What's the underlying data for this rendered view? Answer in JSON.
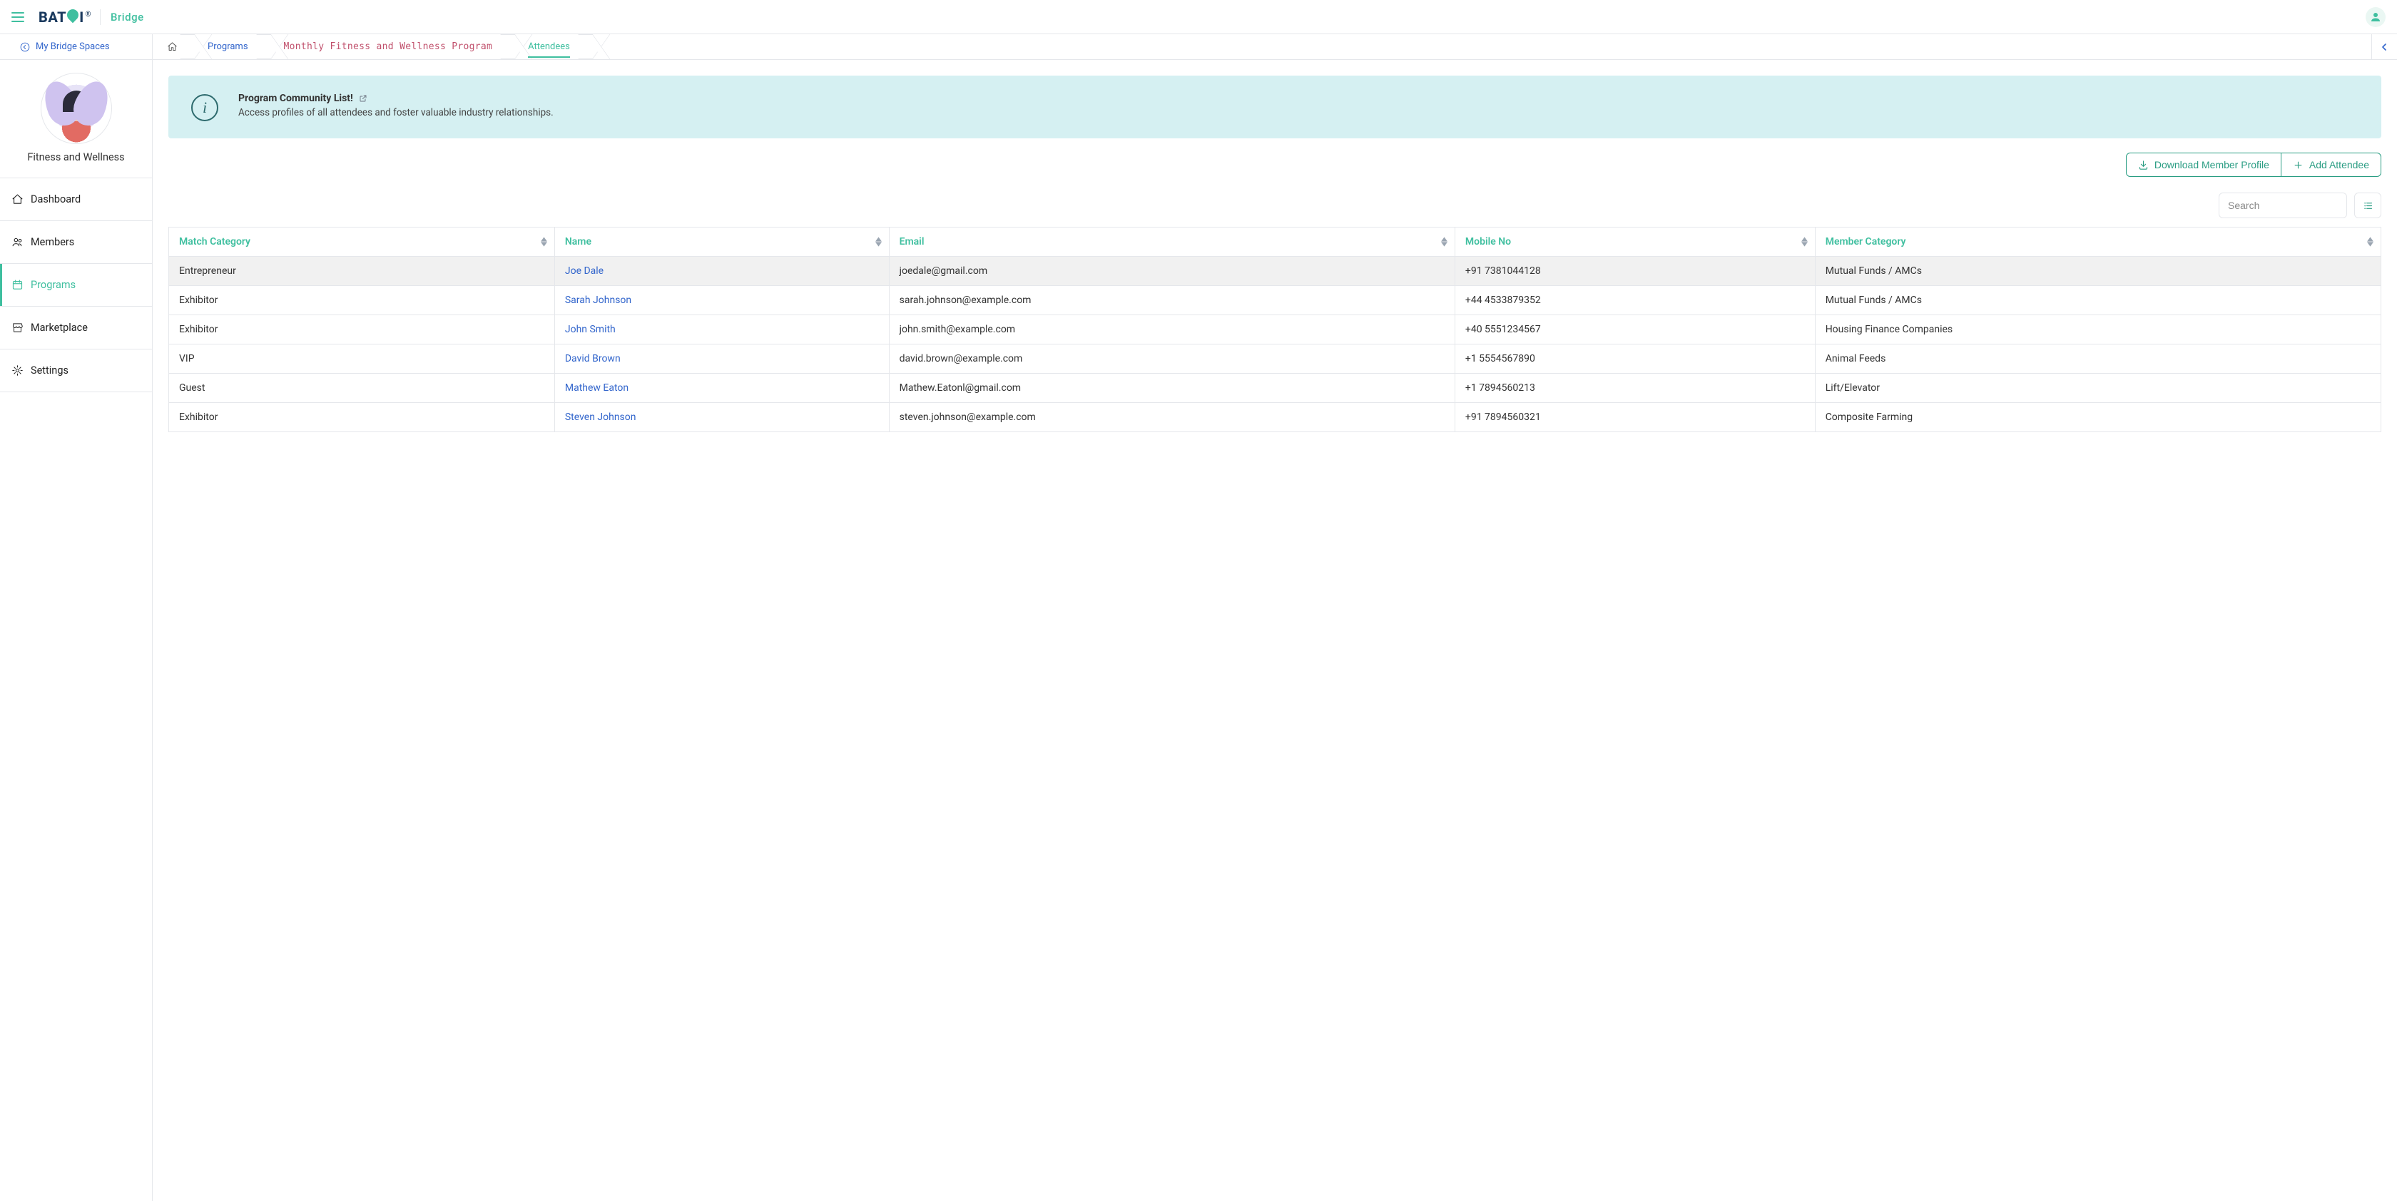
{
  "app": {
    "logo_text_left": "BAT",
    "logo_text_right": "I",
    "logo_reg": "®",
    "product": "Bridge"
  },
  "crumbs": {
    "spaces_label": "My Bridge Spaces",
    "programs": "Programs",
    "program_name": "Monthly Fitness and Wellness Program",
    "attendees": "Attendees"
  },
  "sidebar": {
    "space_title": "Fitness and Wellness",
    "items": [
      {
        "label": "Dashboard"
      },
      {
        "label": "Members"
      },
      {
        "label": "Programs"
      },
      {
        "label": "Marketplace"
      },
      {
        "label": "Settings"
      }
    ]
  },
  "infobox": {
    "title": "Program Community List!",
    "body": "Access profiles of all attendees and foster valuable industry relationships."
  },
  "toolbar": {
    "download_label": "Download Member Profile",
    "add_label": "Add Attendee"
  },
  "search": {
    "placeholder": "Search"
  },
  "table": {
    "headers": {
      "match_category": "Match Category",
      "name": "Name",
      "email": "Email",
      "mobile": "Mobile No",
      "member_category": "Member Category"
    },
    "rows": [
      {
        "match_category": "Entrepreneur",
        "name": "Joe Dale",
        "email": "joedale@gmail.com",
        "mobile": "+91 7381044128",
        "member_category": "Mutual Funds / AMCs"
      },
      {
        "match_category": "Exhibitor",
        "name": "Sarah Johnson",
        "email": "sarah.johnson@example.com",
        "mobile": "+44 4533879352",
        "member_category": "Mutual Funds / AMCs"
      },
      {
        "match_category": "Exhibitor",
        "name": "John Smith",
        "email": "john.smith@example.com",
        "mobile": "+40 5551234567",
        "member_category": "Housing Finance Companies"
      },
      {
        "match_category": "VIP",
        "name": "David Brown",
        "email": "david.brown@example.com",
        "mobile": "+1 5554567890",
        "member_category": "Animal Feeds"
      },
      {
        "match_category": "Guest",
        "name": "Mathew Eaton",
        "email": "Mathew.Eatonl@gmail.com",
        "mobile": "+1 7894560213",
        "member_category": "Lift/Elevator"
      },
      {
        "match_category": "Exhibitor",
        "name": "Steven Johnson",
        "email": "steven.johnson@example.com",
        "mobile": "+91 7894560321",
        "member_category": "Composite Farming"
      }
    ]
  }
}
